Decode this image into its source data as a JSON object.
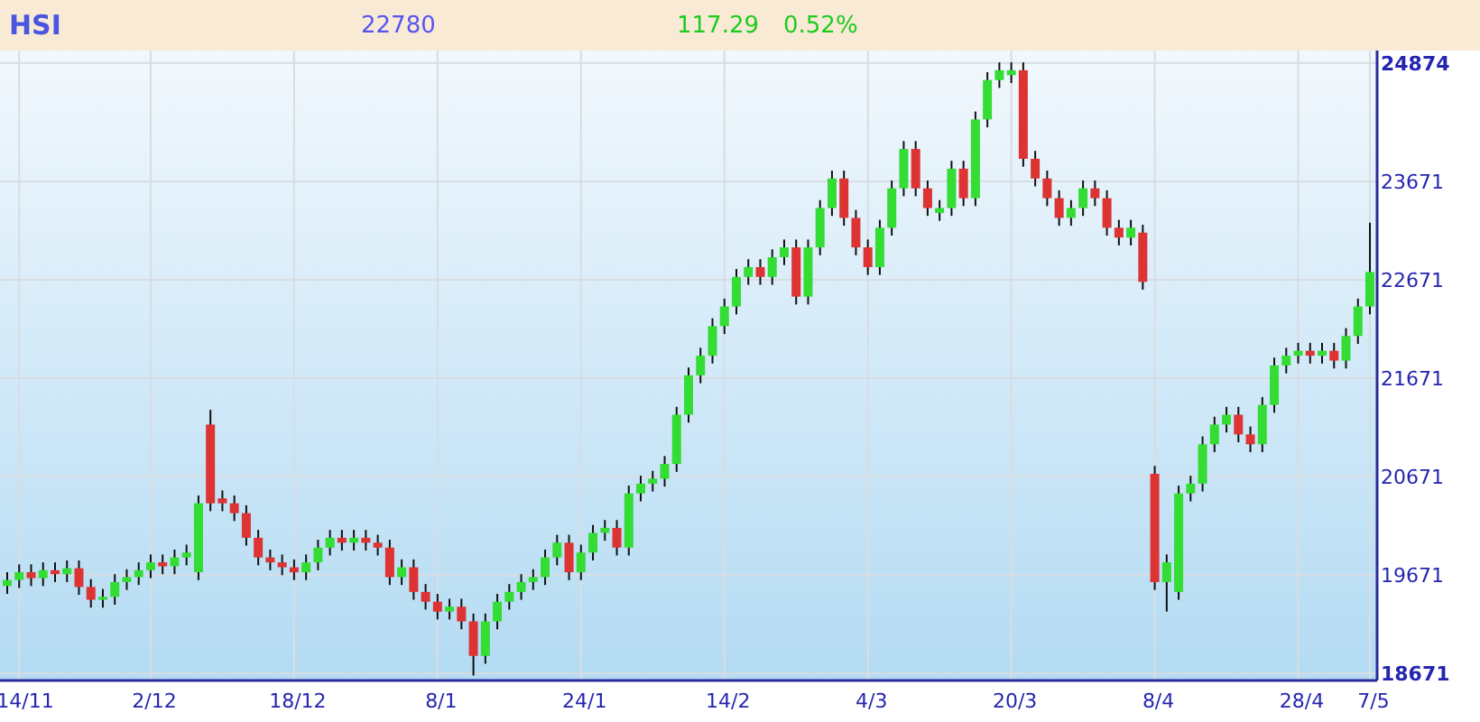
{
  "header": {
    "symbol": "HSI",
    "last": "22780",
    "change": "117.29",
    "change_percent": "0.52%"
  },
  "chart": {
    "chart_data": {
      "type": "candlestick",
      "ylim": [
        18600,
        25000
      ],
      "grid": true,
      "yticks": [
        18671,
        19671,
        20671,
        21671,
        22671,
        23671,
        24874
      ],
      "categories": [
        null,
        "14/11",
        null,
        null,
        null,
        null,
        null,
        null,
        null,
        null,
        null,
        null,
        "2/12",
        null,
        null,
        null,
        null,
        null,
        null,
        null,
        null,
        null,
        null,
        null,
        "18/12",
        null,
        null,
        null,
        null,
        null,
        null,
        null,
        null,
        null,
        null,
        null,
        "8/1",
        null,
        null,
        null,
        null,
        null,
        null,
        null,
        null,
        null,
        null,
        null,
        "24/1",
        null,
        null,
        null,
        null,
        null,
        null,
        null,
        null,
        null,
        null,
        null,
        "14/2",
        null,
        null,
        null,
        null,
        null,
        null,
        null,
        null,
        null,
        null,
        null,
        "4/3",
        null,
        null,
        null,
        null,
        null,
        null,
        null,
        null,
        null,
        null,
        null,
        "20/3",
        null,
        null,
        null,
        null,
        null,
        null,
        null,
        null,
        null,
        null,
        null,
        "8/4",
        null,
        null,
        null,
        null,
        null,
        null,
        null,
        null,
        null,
        null,
        null,
        "28/4",
        null,
        null,
        null,
        null,
        null,
        "7/5"
      ],
      "ohlc": [
        [
          19560,
          19700,
          19480,
          19620
        ],
        [
          19620,
          19780,
          19540,
          19700
        ],
        [
          19700,
          19780,
          19560,
          19640
        ],
        [
          19640,
          19800,
          19560,
          19720
        ],
        [
          19720,
          19800,
          19600,
          19680
        ],
        [
          19680,
          19820,
          19600,
          19740
        ],
        [
          19740,
          19820,
          19470,
          19550
        ],
        [
          19550,
          19630,
          19340,
          19420
        ],
        [
          19420,
          19530,
          19340,
          19450
        ],
        [
          19450,
          19680,
          19370,
          19600
        ],
        [
          19600,
          19730,
          19520,
          19650
        ],
        [
          19650,
          19800,
          19570,
          19720
        ],
        [
          19720,
          19880,
          19640,
          19800
        ],
        [
          19800,
          19880,
          19680,
          19760
        ],
        [
          19760,
          19930,
          19680,
          19850
        ],
        [
          19850,
          19980,
          19770,
          19900
        ],
        [
          19700,
          20480,
          19620,
          20400
        ],
        [
          21200,
          21350,
          20320,
          20400
        ],
        [
          20450,
          20530,
          20320,
          20400
        ],
        [
          20400,
          20480,
          20220,
          20300
        ],
        [
          20300,
          20380,
          19970,
          20050
        ],
        [
          20050,
          20130,
          19770,
          19850
        ],
        [
          19850,
          19930,
          19720,
          19800
        ],
        [
          19800,
          19880,
          19670,
          19750
        ],
        [
          19750,
          19830,
          19620,
          19700
        ],
        [
          19700,
          19880,
          19620,
          19800
        ],
        [
          19800,
          20030,
          19720,
          19950
        ],
        [
          19950,
          20130,
          19870,
          20050
        ],
        [
          20050,
          20130,
          19920,
          20000
        ],
        [
          20000,
          20130,
          19920,
          20050
        ],
        [
          20050,
          20130,
          19920,
          20000
        ],
        [
          20000,
          20080,
          19870,
          19950
        ],
        [
          19950,
          20030,
          19570,
          19650
        ],
        [
          19650,
          19830,
          19570,
          19750
        ],
        [
          19750,
          19830,
          19420,
          19500
        ],
        [
          19500,
          19580,
          19320,
          19400
        ],
        [
          19400,
          19480,
          19220,
          19300
        ],
        [
          19300,
          19430,
          19220,
          19350
        ],
        [
          19350,
          19430,
          19120,
          19200
        ],
        [
          19200,
          19280,
          18650,
          18850
        ],
        [
          18850,
          19280,
          18770,
          19200
        ],
        [
          19200,
          19480,
          19120,
          19400
        ],
        [
          19400,
          19580,
          19320,
          19500
        ],
        [
          19500,
          19680,
          19420,
          19600
        ],
        [
          19600,
          19730,
          19520,
          19650
        ],
        [
          19650,
          19930,
          19570,
          19850
        ],
        [
          19850,
          20080,
          19770,
          20000
        ],
        [
          20000,
          20080,
          19620,
          19700
        ],
        [
          19700,
          19980,
          19620,
          19900
        ],
        [
          19900,
          20180,
          19820,
          20100
        ],
        [
          20100,
          20230,
          20020,
          20150
        ],
        [
          20150,
          20230,
          19870,
          19950
        ],
        [
          19950,
          20580,
          19870,
          20500
        ],
        [
          20500,
          20680,
          20420,
          20600
        ],
        [
          20600,
          20730,
          20520,
          20650
        ],
        [
          20650,
          20880,
          20570,
          20800
        ],
        [
          20800,
          21380,
          20720,
          21300
        ],
        [
          21300,
          21780,
          21220,
          21700
        ],
        [
          21700,
          21980,
          21620,
          21900
        ],
        [
          21900,
          22280,
          21820,
          22200
        ],
        [
          22200,
          22480,
          22120,
          22400
        ],
        [
          22400,
          22780,
          22320,
          22700
        ],
        [
          22700,
          22880,
          22620,
          22800
        ],
        [
          22800,
          22880,
          22620,
          22700
        ],
        [
          22700,
          22980,
          22620,
          22900
        ],
        [
          22900,
          23080,
          22820,
          23000
        ],
        [
          23000,
          23080,
          22420,
          22500
        ],
        [
          22500,
          23080,
          22420,
          23000
        ],
        [
          23000,
          23480,
          22920,
          23400
        ],
        [
          23400,
          23780,
          23320,
          23700
        ],
        [
          23700,
          23780,
          23220,
          23300
        ],
        [
          23300,
          23380,
          22920,
          23000
        ],
        [
          23000,
          23080,
          22720,
          22800
        ],
        [
          22800,
          23280,
          22720,
          23200
        ],
        [
          23200,
          23680,
          23120,
          23600
        ],
        [
          23600,
          24080,
          23520,
          24000
        ],
        [
          24000,
          24080,
          23520,
          23600
        ],
        [
          23600,
          23680,
          23320,
          23400
        ],
        [
          23350,
          23480,
          23270,
          23400
        ],
        [
          23400,
          23880,
          23320,
          23800
        ],
        [
          23800,
          23880,
          23420,
          23500
        ],
        [
          23500,
          24380,
          23420,
          24300
        ],
        [
          24300,
          24780,
          24220,
          24700
        ],
        [
          24700,
          24880,
          24620,
          24800
        ],
        [
          24750,
          24880,
          24670,
          24800
        ],
        [
          24800,
          24880,
          23820,
          23900
        ],
        [
          23900,
          23980,
          23620,
          23700
        ],
        [
          23700,
          23780,
          23420,
          23500
        ],
        [
          23500,
          23580,
          23220,
          23300
        ],
        [
          23300,
          23480,
          23220,
          23400
        ],
        [
          23400,
          23680,
          23320,
          23600
        ],
        [
          23600,
          23680,
          23420,
          23500
        ],
        [
          23500,
          23580,
          23120,
          23200
        ],
        [
          23200,
          23280,
          23020,
          23100
        ],
        [
          23100,
          23280,
          23020,
          23200
        ],
        [
          23150,
          23230,
          22570,
          22650
        ],
        [
          20700,
          20780,
          19520,
          19600
        ],
        [
          19600,
          19880,
          19300,
          19800
        ],
        [
          19500,
          20580,
          19420,
          20500
        ],
        [
          20500,
          20680,
          20420,
          20600
        ],
        [
          20600,
          21080,
          20520,
          21000
        ],
        [
          21000,
          21280,
          20920,
          21200
        ],
        [
          21200,
          21380,
          21120,
          21300
        ],
        [
          21300,
          21380,
          21020,
          21100
        ],
        [
          21100,
          21180,
          20920,
          21000
        ],
        [
          21000,
          21480,
          20920,
          21400
        ],
        [
          21400,
          21880,
          21320,
          21800
        ],
        [
          21800,
          21980,
          21720,
          21900
        ],
        [
          21900,
          22030,
          21820,
          21950
        ],
        [
          21950,
          22030,
          21820,
          21900
        ],
        [
          21900,
          22030,
          21820,
          21950
        ],
        [
          21950,
          22030,
          21770,
          21850
        ],
        [
          21850,
          22180,
          21770,
          22100
        ],
        [
          22100,
          22480,
          22020,
          22400
        ],
        [
          22400,
          23250,
          22320,
          22750
        ]
      ]
    }
  }
}
